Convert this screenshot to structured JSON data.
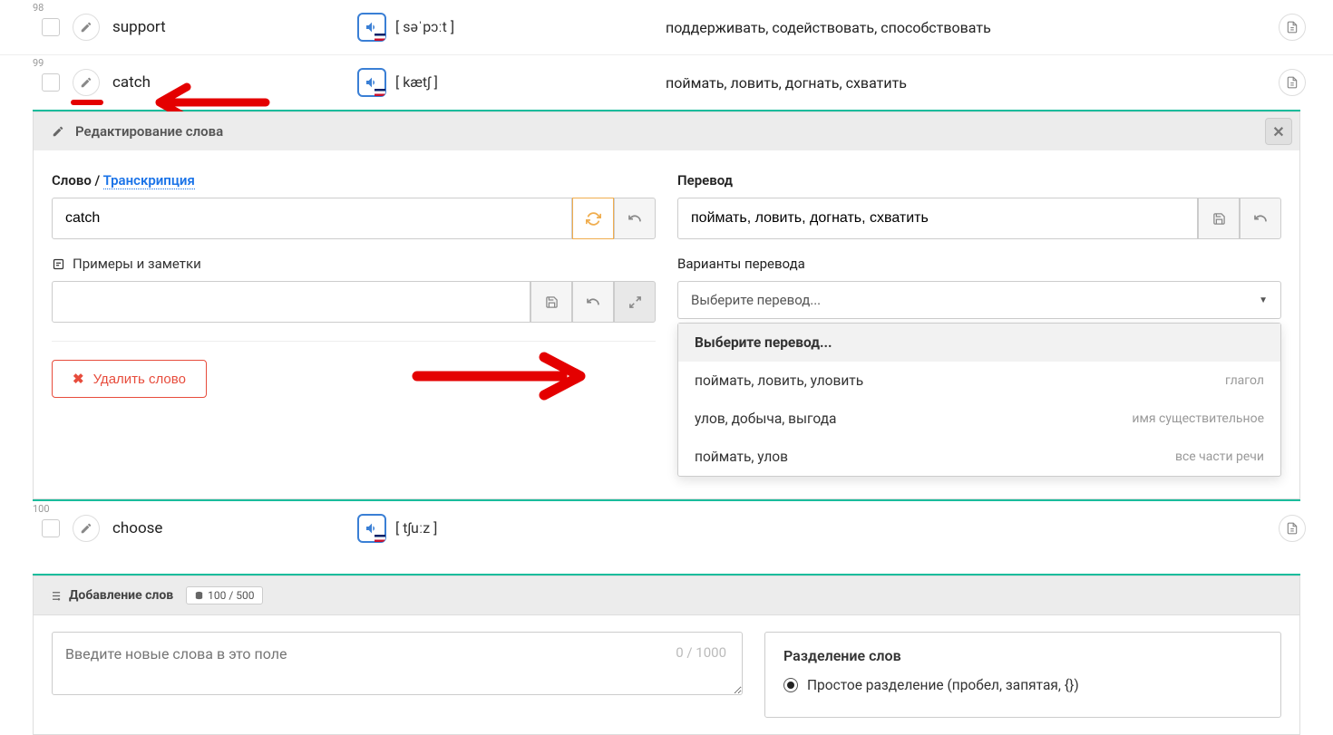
{
  "rows": [
    {
      "num": "98",
      "word": "support",
      "transcription": "[ səˈpɔːt ]",
      "translation": "поддерживать, содействовать, способствовать"
    },
    {
      "num": "99",
      "word": "catch",
      "transcription": "[ kætʃ ]",
      "translation": "поймать, ловить, догнать, схватить"
    },
    {
      "num": "100",
      "word": "choose",
      "transcription": "[ tʃuːz ]",
      "translation": ""
    }
  ],
  "editor": {
    "title": "Редактирование слова",
    "word_label": "Слово",
    "slash": " / ",
    "trans_link": "Транскрипция",
    "word_value": "catch",
    "notes_label": "Примеры и заметки",
    "delete_label": "Удалить слово",
    "translation_label": "Перевод",
    "translation_value": "поймать, ловить, догнать, схватить",
    "variants_label": "Варианты перевода",
    "variants_placeholder": "Выберите перевод...",
    "dropdown_header": "Выберите перевод...",
    "options": [
      {
        "text": "поймать, ловить, уловить",
        "pos": "глагол"
      },
      {
        "text": "улов, добыча, выгода",
        "pos": "имя существительное"
      },
      {
        "text": "поймать, улов",
        "pos": "все части речи"
      }
    ]
  },
  "add": {
    "title": "Добавление слов",
    "count": "100 / 500",
    "textarea_placeholder": "Введите новые слова в это поле",
    "char_count": "0 / 1000",
    "separation_title": "Разделение слов",
    "option1": "Простое разделение (пробел, запятая, {})"
  }
}
